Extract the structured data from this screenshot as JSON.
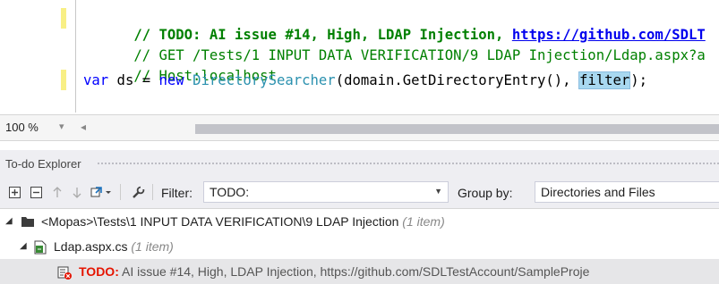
{
  "editor": {
    "lines": [
      {
        "todo_word": "// TODO: AI issue #14, High, LDAP Injection, ",
        "link": "https://github.com/SDLT"
      },
      {
        "comment": "// GET /Tests/1 INPUT DATA VERIFICATION/9 LDAP Injection/Ldap.aspx?a"
      },
      {
        "comment": "// Host:localhost"
      },
      {
        "kw_var": "var",
        "ident1": " ds = ",
        "kw_new": "new",
        "space": " ",
        "type": "DirectorySearcher",
        "args": "(domain.GetDirectoryEntry(), ",
        "highlight": "filter",
        "end": ");"
      }
    ]
  },
  "status": {
    "zoom": "100 %",
    "zoom_arrow": "▾",
    "scroll_left": "◂"
  },
  "todo_explorer": {
    "title": "To-do Explorer",
    "filter_label": "Filter:",
    "filter_value": "TODO:",
    "group_label": "Group by:",
    "group_value": "Directories and Files",
    "tree": [
      {
        "path": "<Mopas>\\Tests\\1 INPUT DATA VERIFICATION\\9 LDAP Injection",
        "count": "(1 item)"
      },
      {
        "path": "Ldap.aspx.cs",
        "count": "(1 item)"
      },
      {
        "todo": "TODO:",
        "text": " AI issue #14, High, LDAP Injection, https://github.com/SDLTestAccount/SampleProje"
      }
    ]
  },
  "colors": {
    "change_bar": "#f8ef85",
    "comment": "#008000",
    "keyword": "#0000ff",
    "type": "#2b91af",
    "todo_red": "#e51400"
  }
}
